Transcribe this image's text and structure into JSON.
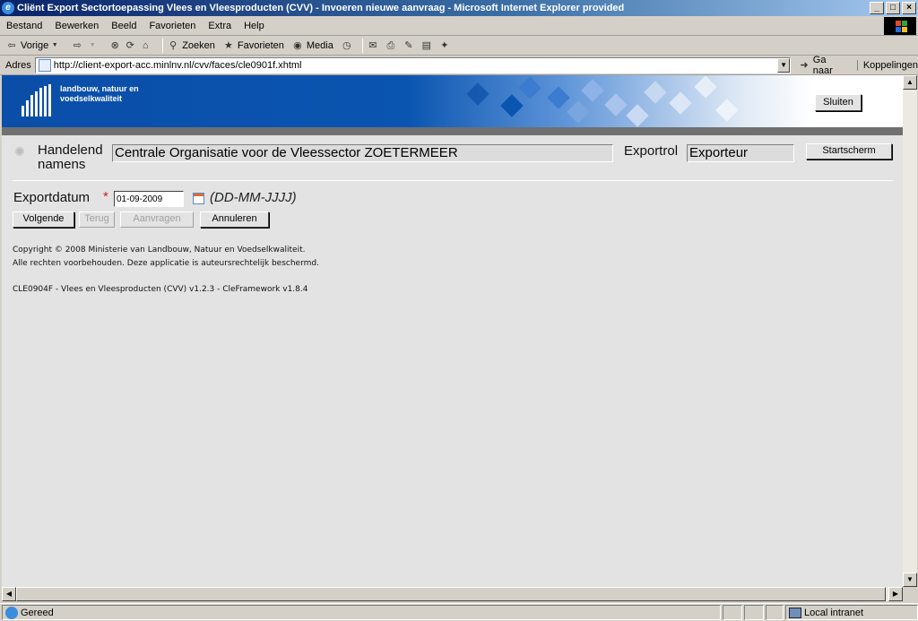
{
  "window": {
    "title": "Cliënt Export Sectortoepassing Vlees en Vleesproducten (CVV) - Invoeren nieuwe aanvraag - Microsoft Internet Explorer provided",
    "controls": [
      "_",
      "□",
      "×"
    ]
  },
  "menu": [
    "Bestand",
    "Bewerken",
    "Beeld",
    "Favorieten",
    "Extra",
    "Help"
  ],
  "toolbar": {
    "back_label": "Vorige",
    "search_label": "Zoeken",
    "favorites_label": "Favorieten",
    "media_label": "Media"
  },
  "address": {
    "label": "Adres",
    "url": "http://client-export-acc.minlnv.nl/cvv/faces/cle0901f.xhtml",
    "go_label": "Ga naar",
    "links_label": "Koppelingen"
  },
  "banner": {
    "org_line1": "landbouw, natuur en",
    "org_line2": "voedselkwaliteit",
    "close_label": "Sluiten"
  },
  "header": {
    "handelend_label_1": "Handelend",
    "handelend_label_2": "namens",
    "organisation": "Centrale Organisatie voor de Vleessector ZOETERMEER",
    "exportrol_label": "Exportrol",
    "exportrol_value": "Exporteur",
    "start_label": "Startscherm"
  },
  "form": {
    "exportdatum_label": "Exportdatum",
    "required_mark": "*",
    "exportdatum_value": "01-09-2009",
    "date_format_hint": "(DD-MM-JJJJ)"
  },
  "buttons": {
    "next": "Volgende",
    "back": "Terug",
    "request": "Aanvragen",
    "cancel": "Annuleren"
  },
  "footer": {
    "copyright_1": "Copyright © 2008 Ministerie van Landbouw, Natuur en Voedselkwaliteit.",
    "copyright_2": "Alle rechten voorbehouden. Deze applicatie is auteursrechtelijk beschermd.",
    "version": "CLE0904F - Vlees en Vleesproducten (CVV) v1.2.3 - CleFramework v1.8.4"
  },
  "status": {
    "text": "Gereed",
    "zone": "Local intranet"
  },
  "colors": {
    "banner_blue": "#0a55b0",
    "required_red": "#d02020",
    "title_bar": "#0a246a"
  }
}
